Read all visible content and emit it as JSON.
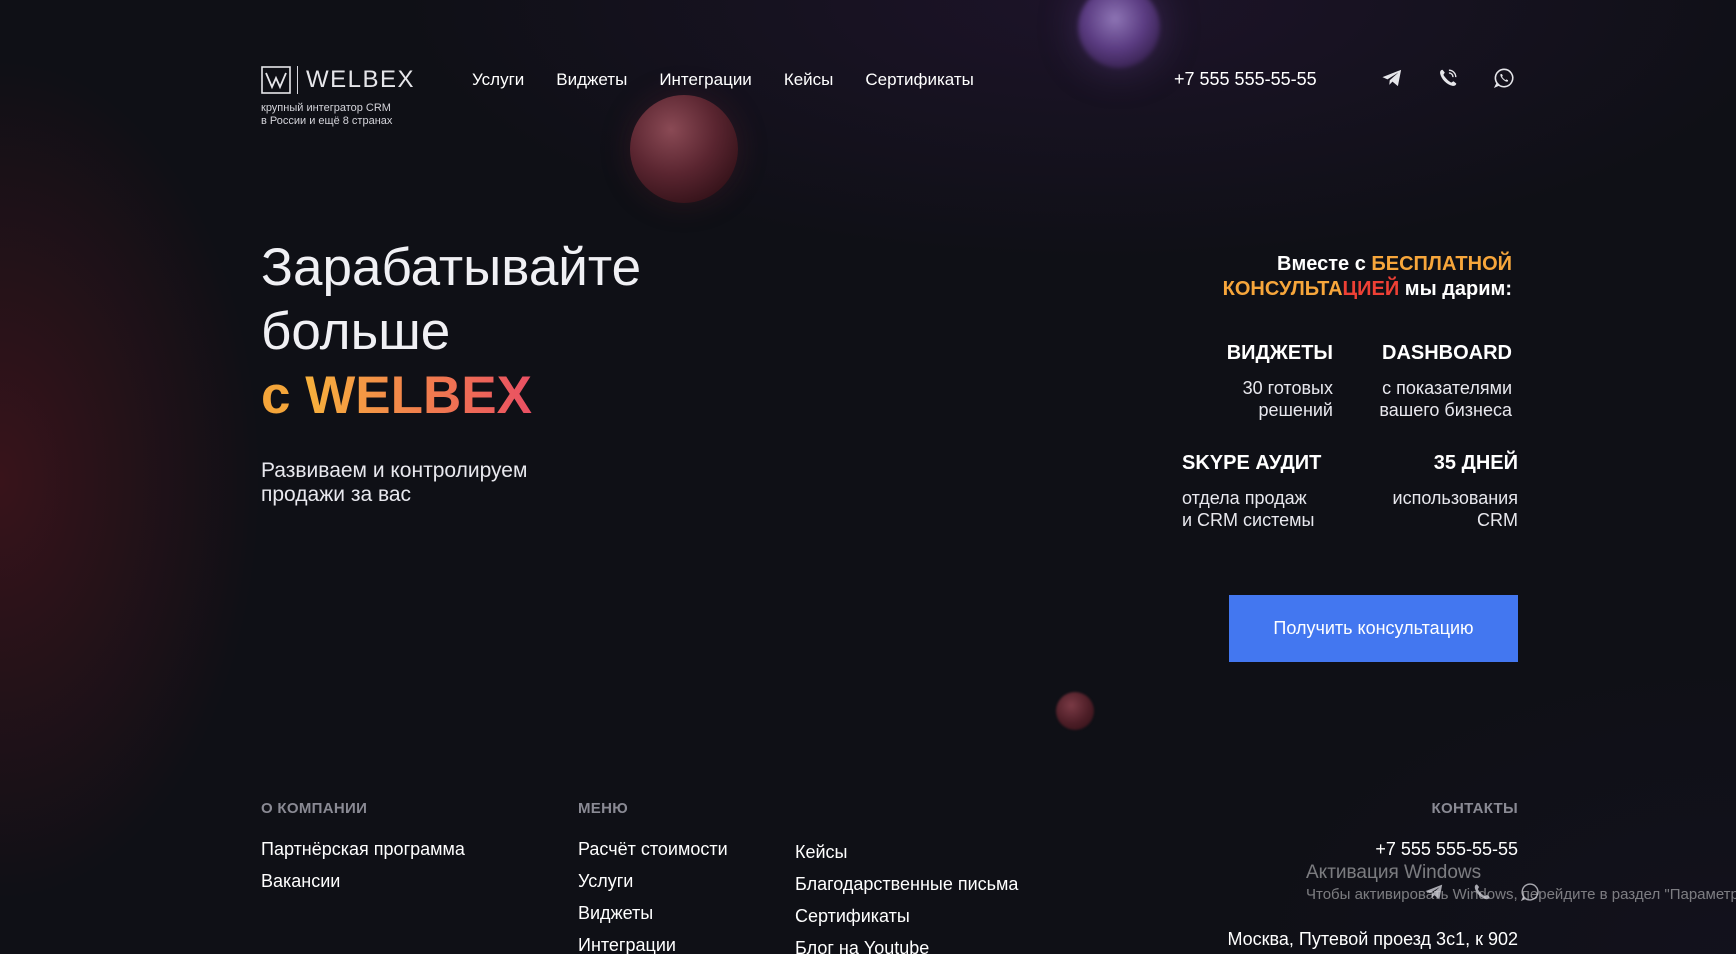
{
  "brand": {
    "name": "WELBEX",
    "tagline_line1": "крупный интегратор CRM",
    "tagline_line2": "в России и ещё 8 странах"
  },
  "nav": {
    "items": [
      "Услуги",
      "Виджеты",
      "Интеграции",
      "Кейсы",
      "Сертификаты"
    ]
  },
  "header": {
    "phone": "+7 555 555-55-55",
    "social_icons": [
      "telegram-icon",
      "viber-icon",
      "whatsapp-icon"
    ]
  },
  "hero": {
    "title_line1": "Зарабатывайте",
    "title_line2": "больше",
    "title_prefix": "с",
    "title_brand": "WELBEX",
    "subtitle_line1": "Развиваем и контролируем",
    "subtitle_line2": "продажи за вас"
  },
  "offer": {
    "intro_part1": "Вместе с ",
    "intro_highlight1": "БЕСПЛАТНОЙ",
    "intro_highlight2_part1": "КОНСУЛЬТА",
    "intro_highlight2_part2": "ЦИЕЙ",
    "intro_part2": " мы дарим:",
    "features": [
      {
        "title": "ВИДЖЕТЫ",
        "desc_line1": "30 готовых",
        "desc_line2": "решений"
      },
      {
        "title": "DASHBOARD",
        "desc_line1": "с показателями",
        "desc_line2": "вашего бизнеса"
      },
      {
        "title": "SKYPE АУДИТ",
        "desc_line1": "отдела продаж",
        "desc_line2": "и CRM системы"
      },
      {
        "title": "35 ДНЕЙ",
        "desc_line1": "использования",
        "desc_line2": "CRM"
      }
    ],
    "cta_label": "Получить консультацию"
  },
  "footer": {
    "company": {
      "heading": "О КОМПАНИИ",
      "links": [
        "Партнёрская программа",
        "Вакансии"
      ]
    },
    "menu": {
      "heading": "МЕНЮ",
      "col1": [
        "Расчёт стоимости",
        "Услуги",
        "Виджеты",
        "Интеграции"
      ],
      "col2": [
        "Кейсы",
        "Благодарственные письма",
        "Сертификаты",
        "Блог на Youtube"
      ]
    },
    "contacts": {
      "heading": "КОНТАКТЫ",
      "phone": "+7 555 555-55-55",
      "address": "Москва, Путевой проезд 3с1, к 902"
    }
  },
  "windows_watermark": {
    "title": "Активация Windows",
    "subtitle": "Чтобы активировать Windows, перейдите в раздел \"Параметры\""
  },
  "colors": {
    "background": "#0f1016",
    "accent_orange": "#f7a63b",
    "accent_red": "#ee4035",
    "cta_blue": "#4377f0"
  }
}
